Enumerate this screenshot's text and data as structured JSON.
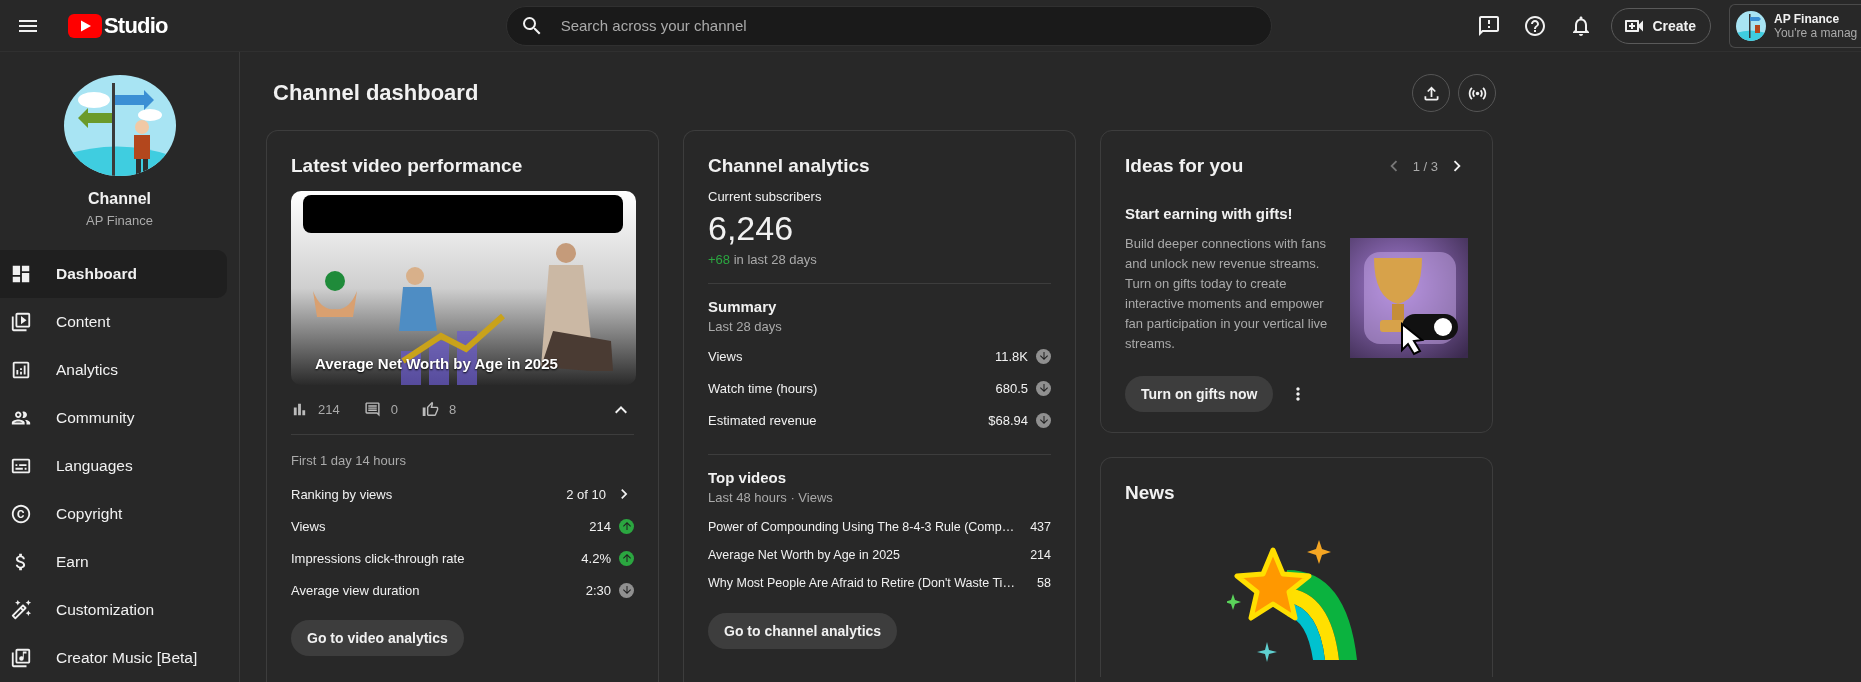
{
  "top_bar": {
    "logo_text": "Studio",
    "search": {
      "placeholder": "Search across your channel"
    },
    "create_button": "Create",
    "account": {
      "name": "AP Finance",
      "role": "You're a manag"
    }
  },
  "sidebar": {
    "channel_label": "Channel",
    "channel_name": "AP Finance",
    "items": [
      {
        "label": "Dashboard",
        "kind": "dashboard",
        "selected": true
      },
      {
        "label": "Content",
        "kind": "content",
        "selected": false
      },
      {
        "label": "Analytics",
        "kind": "analytics",
        "selected": false
      },
      {
        "label": "Community",
        "kind": "community",
        "selected": false
      },
      {
        "label": "Languages",
        "kind": "languages",
        "selected": false
      },
      {
        "label": "Copyright",
        "kind": "copyright",
        "selected": false
      },
      {
        "label": "Earn",
        "kind": "earn",
        "selected": false
      },
      {
        "label": "Customization",
        "kind": "customization",
        "selected": false
      },
      {
        "label": "Creator Music [Beta]",
        "kind": "music",
        "selected": false
      }
    ]
  },
  "page_title": "Channel dashboard",
  "latest_video": {
    "title": "Latest video performance",
    "video_title": "Average Net Worth by Age in 2025",
    "stats": [
      {
        "kind": "views",
        "value": "214"
      },
      {
        "kind": "comments",
        "value": "0"
      },
      {
        "kind": "likes",
        "value": "8"
      }
    ],
    "expanded": true,
    "period": "First 1 day 14 hours",
    "ranking": {
      "label": "Ranking by views",
      "value": "2 of 10"
    },
    "metrics": [
      {
        "label": "Views",
        "value": "214",
        "trend_up": true
      },
      {
        "label": "Impressions click-through rate",
        "value": "4.2%",
        "trend_up": true
      },
      {
        "label": "Average view duration",
        "value": "2:30",
        "trend_up": false
      }
    ],
    "button": "Go to video analytics"
  },
  "channel_analytics": {
    "title": "Channel analytics",
    "subscribers_label": "Current subscribers",
    "subscribers": "6,246",
    "delta": "+68",
    "delta_text": "in last 28 days",
    "summary": {
      "title": "Summary",
      "subtitle": "Last 28 days",
      "metrics": [
        {
          "label": "Views",
          "value": "11.8K",
          "trend_up": false
        },
        {
          "label": "Watch time (hours)",
          "value": "680.5",
          "trend_up": false
        },
        {
          "label": "Estimated revenue",
          "value": "$68.94",
          "trend_up": false
        }
      ]
    },
    "top_videos": {
      "title": "Top videos",
      "subtitle": "Last 48 hours · Views",
      "rows": [
        {
          "title": "Power of Compounding Using The 8-4-3 Rule (Comp…",
          "views": "437"
        },
        {
          "title": "Average Net Worth by Age in 2025",
          "views": "214"
        },
        {
          "title": "Why Most People Are Afraid to Retire (Don't Waste Ti…",
          "views": "58"
        }
      ]
    },
    "button": "Go to channel analytics"
  },
  "ideas": {
    "title": "Ideas for you",
    "pager": {
      "text": "1 / 3",
      "prev_disabled": true,
      "next_disabled": false
    },
    "heading": "Start earning with gifts!",
    "body": "Build deeper connections with fans and unlock new revenue streams. Turn on gifts today to create interactive moments and empower fan participation in your vertical live streams.",
    "button": "Turn on gifts now"
  },
  "news": {
    "title": "News"
  }
}
